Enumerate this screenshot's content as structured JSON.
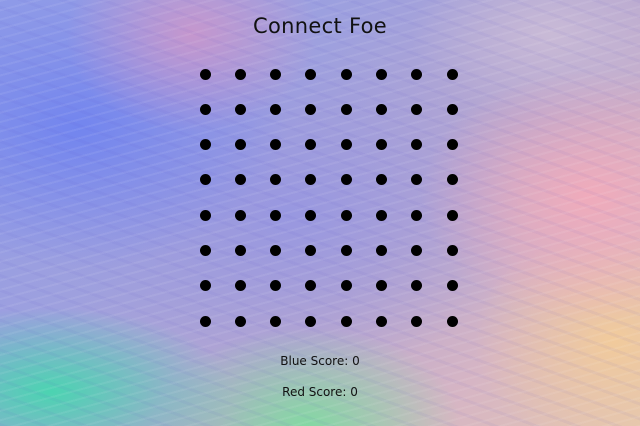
{
  "game": {
    "title": "Connect Foe",
    "rows": 8,
    "cols": 8
  },
  "scores": {
    "blue_label": "Blue Score: 0",
    "red_label": "Red Score: 0",
    "blue": 0,
    "red": 0
  },
  "colors": {
    "dot": "#000000",
    "text": "#111111"
  }
}
